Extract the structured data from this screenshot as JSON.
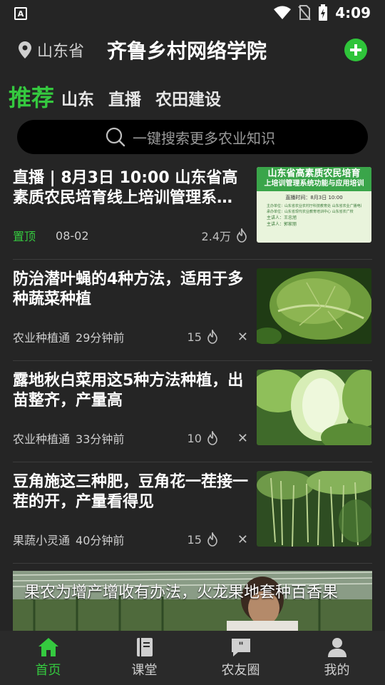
{
  "status_bar": {
    "time": "4:09",
    "left_badge": "A"
  },
  "header": {
    "location": "山东省",
    "title": "齐鲁乡村网络学院"
  },
  "tabs": [
    {
      "label": "推荐",
      "active": true
    },
    {
      "label": "山东",
      "active": false
    },
    {
      "label": "直播",
      "active": false
    },
    {
      "label": "农田建设",
      "active": false
    }
  ],
  "search": {
    "placeholder": "一键搜索更多农业知识"
  },
  "feed": [
    {
      "title": "直播 | 8月3日 10:00 山东省高素质农民培育线上培训管理系…",
      "tag": "置顶",
      "date": "08-02",
      "heat": "2.4万",
      "thumb": {
        "heading1": "山东省高素质农民培育",
        "heading2": "上培训管理系统功能与应用培训",
        "time_line": "直播时间：8月3日 10:00",
        "body_lines": [
          "主办单位：山东省农业农村厅科技教育处 山东省农业广播电视学校",
          "承办单位：山东省现代农业教育培训中心 山东省农广校",
          "主讲人：王忠旭",
          "主讲人：郭家丽"
        ]
      }
    },
    {
      "title": "防治潜叶蝇的4种方法，适用于多种蔬菜种植",
      "source": "农业种植通",
      "time": "29分钟前",
      "heat": "15"
    },
    {
      "title": "露地秋白菜用这5种方法种植，出苗整齐，产量高",
      "source": "农业种植通",
      "time": "33分钟前",
      "heat": "10"
    },
    {
      "title": "豆角施这三种肥，豆角花一茬接一茬的开，产量看得见",
      "source": "果蔬小灵通",
      "time": "40分钟前",
      "heat": "15"
    }
  ],
  "video_card": {
    "caption": "果农为增产增收有办法，火龙果地套种百香果"
  },
  "bottom_nav": [
    {
      "label": "首页",
      "icon": "home-icon",
      "active": true
    },
    {
      "label": "课堂",
      "icon": "book-icon",
      "active": false
    },
    {
      "label": "农友圈",
      "icon": "chat-quote-icon",
      "active": false
    },
    {
      "label": "我的",
      "icon": "user-icon",
      "active": false
    }
  ],
  "colors": {
    "accent": "#35c93f",
    "background": "#252525",
    "search_bg": "#000000"
  }
}
